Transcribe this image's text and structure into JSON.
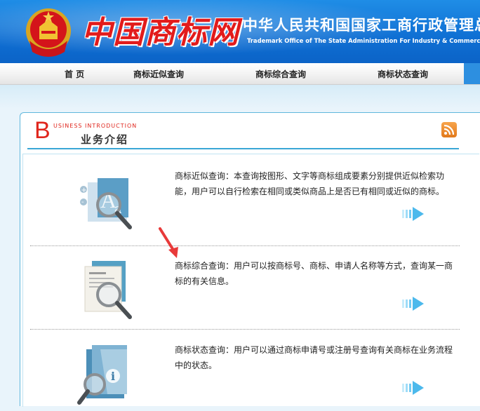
{
  "header": {
    "logo_text": "中国商标网",
    "office_cn": "中华人民共和国国家工商行政管理总局商标局",
    "office_en": "Trademark Office of The State Administration For Industry & Commerce of the People's Republic of China"
  },
  "nav": {
    "items": [
      {
        "label": "首  页"
      },
      {
        "label": "商标近似查询"
      },
      {
        "label": "商标综合查询"
      },
      {
        "label": "商标状态查询"
      }
    ]
  },
  "section": {
    "big_letter": "B",
    "subtitle": "USINESS  INTRODUCTION",
    "title": "业务介绍"
  },
  "services": [
    {
      "text": "商标近似查询：本查询按图形、文字等商标组成要素分别提供近似检索功能，用户可以自行检索在相同或类似商品上是否已有相同或近似的商标。",
      "icon": "similar-search-icon"
    },
    {
      "text": "商标综合查询：用户可以按商标号、商标、申请人名称等方式，查询某一商标的有关信息。",
      "icon": "document-search-icon"
    },
    {
      "text": "商标状态查询：用户可以通过商标申请号或注册号查询有关商标在业务流程中的状态。",
      "icon": "info-search-icon"
    }
  ],
  "colors": {
    "header_blue": "#0f6fd3",
    "accent_red": "#e0261d",
    "line_blue": "#3aa6d6"
  }
}
